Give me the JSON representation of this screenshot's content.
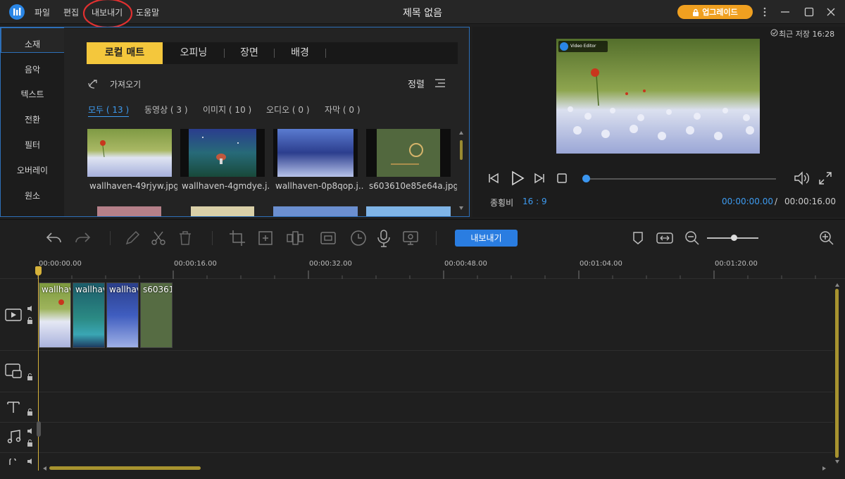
{
  "app": {
    "title": "제목 없음",
    "menu": [
      "파일",
      "편집",
      "내보내기",
      "도움말"
    ],
    "upgrade_label": "업그레이드",
    "accent": "#f4c73c",
    "blue": "#2a7de1"
  },
  "sidebar": {
    "items": [
      {
        "label": "소재"
      },
      {
        "label": "음악"
      },
      {
        "label": "텍스트"
      },
      {
        "label": "전환"
      },
      {
        "label": "필터"
      },
      {
        "label": "오버레이"
      },
      {
        "label": "원소"
      }
    ]
  },
  "media": {
    "tabs": [
      "로컬 매트",
      "오피닝",
      "장면",
      "배경"
    ],
    "import_label": "가져오기",
    "sort_label": "정렬",
    "filters": [
      "모두 ( 13 )",
      "동영상 ( 3 )",
      "이미지 ( 10 )",
      "오디오 ( 0 )",
      "자막 ( 0 )"
    ],
    "items": [
      {
        "name": "wallhaven-49rjyw.jpg"
      },
      {
        "name": "wallhaven-4gmdye.j..."
      },
      {
        "name": "wallhaven-0p8qop.j..."
      },
      {
        "name": "s603610e85e64a.jpg"
      }
    ]
  },
  "preview": {
    "saved_label": "최근 저장 16:28",
    "watermark": "Video Editor",
    "aspect_label": "종횡비",
    "aspect_value": "16 : 9",
    "current_time": "00:00:00.00",
    "separator": "/",
    "total_time": "00:00:16.00"
  },
  "toolbar": {
    "export_label": "내보내기"
  },
  "timeline": {
    "ruler": [
      "00:00:00.00",
      "00:00:16.00",
      "00:00:32.00",
      "00:00:48.00",
      "00:01:04.00",
      "00:01:20.00"
    ],
    "clips": [
      {
        "label": "wallhav"
      },
      {
        "label": "wallhav"
      },
      {
        "label": "wallhav"
      },
      {
        "label": "s60361"
      }
    ]
  }
}
